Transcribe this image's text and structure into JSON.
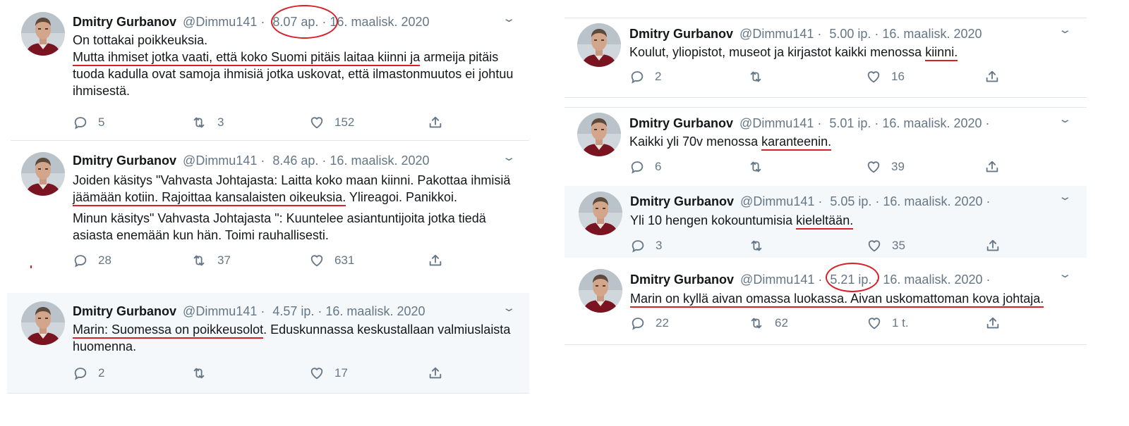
{
  "tweets": [
    {
      "name": "Dmitry Gurbanov",
      "handle": "@Dimmu141",
      "time": "8.07 ap.",
      "date": "16. maalisk. 2020",
      "text1a": "On tottakai poikkeuksia.",
      "text2u": "Mutta ihmiset jotka vaati, että koko Suomi pitäis laitaa kiinni ja",
      "text2r": " armeija pitäis tuoda kadulla ovat samoja ihmisiä jotka uskovat, että ilmastonmuutos ei johtuu ihmisestä.",
      "replies": "5",
      "retweets": "3",
      "likes": "152"
    },
    {
      "name": "Dmitry Gurbanov",
      "handle": "@Dimmu141",
      "time": "8.46 ap.",
      "date": "16. maalisk. 2020",
      "text1u": "Joiden käsitys \"Vahvasta Johtajasta: Laitta koko maan kiinni. Pakottaa ihmisiä jäämään kotiin. Rajoittaa kansalaisten oikeuksia.",
      "text1r": " Ylireagoi. Panikkoi.",
      "text2": "Minun käsitys\" Vahvasta Johtajasta \": Kuuntelee asiantuntijoita jotka tiedä asiasta enemään kun hän. Toimi rauhallisesti.",
      "replies": "28",
      "retweets": "37",
      "likes": "631"
    },
    {
      "name": "Dmitry Gurbanov",
      "handle": "@Dimmu141",
      "time": "4.57 ip.",
      "date": "16. maalisk. 2020",
      "text1u": "Marin: Suomessa on poikkeusolot",
      "text1r": ". Eduskunnassa keskustallaan valmiuslaista huomenna.",
      "replies": "2",
      "retweets": "",
      "likes": "17"
    },
    {
      "name": "Dmitry Gurbanov",
      "handle": "@Dimmu141",
      "time": "5.00 ip.",
      "date": "16. maalisk. 2020",
      "text1a": "Koulut, yliopistot, museot ja kirjastot kaikki menossa ",
      "text1u": "kiinni.",
      "replies": "2",
      "retweets": "",
      "likes": "16"
    },
    {
      "name": "Dmitry Gurbanov",
      "handle": "@Dimmu141",
      "time": "5.01 ip.",
      "date": "16. maalisk. 2020",
      "text1a": "Kaikki yli 70v menossa ",
      "text1u": "karanteenin.",
      "replies": "6",
      "retweets": "",
      "likes": "39"
    },
    {
      "name": "Dmitry Gurbanov",
      "handle": "@Dimmu141",
      "time": "5.05 ip.",
      "date": "16. maalisk. 2020",
      "text1a": "Yli 10 hengen kokountumisia ",
      "text1u": "kieleltään.",
      "replies": "3",
      "retweets": "",
      "likes": "35"
    },
    {
      "name": "Dmitry Gurbanov",
      "handle": "@Dimmu141",
      "time": "5.21 ip.",
      "date": "16. maalisk. 2020",
      "text1u": "Marin on kyllä aivan omassa luokassa. Aivan uskomattoman kova johtaja.",
      "replies": "22",
      "retweets": "62",
      "likes": "1 t."
    }
  ],
  "separator": " · ",
  "icons": [
    "reply-icon",
    "retweet-icon",
    "like-icon",
    "share-icon",
    "chevron-down-icon"
  ],
  "colors": {
    "annotation_red": "#d8202a",
    "muted": "#657786",
    "highlight_bg": "#f5f8fa"
  }
}
